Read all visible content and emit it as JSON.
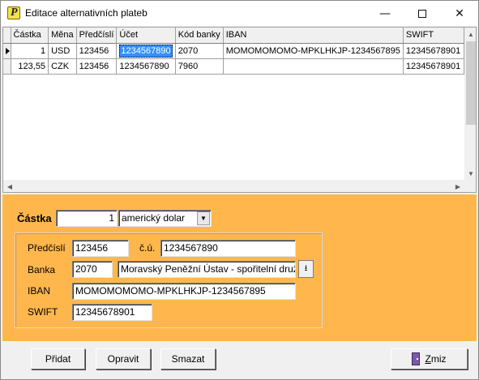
{
  "window": {
    "title": "Editace alternativních plateb",
    "controls": {
      "minimize": "—",
      "close": "✕"
    }
  },
  "grid": {
    "columns": [
      "Částka",
      "Měna",
      "Předčíslí",
      "Účet",
      "Kód banky",
      "IBAN",
      "SWIFT"
    ],
    "rows": [
      {
        "castka": "1",
        "mena": "USD",
        "predcisli": "123456",
        "ucet": "1234567890",
        "kod_banky": "2070",
        "iban": "MOMOMOMOMO-MPKLHKJP-1234567895",
        "swift": "12345678901",
        "current": true
      },
      {
        "castka": "123,55",
        "mena": "CZK",
        "predcisli": "123456",
        "ucet": "1234567890",
        "kod_banky": "7960",
        "iban": "",
        "swift": "12345678901",
        "current": false
      }
    ]
  },
  "form": {
    "castka_label": "Částka",
    "castka_value": "1",
    "mena_value": "americký dolar",
    "predcisli_label": "Předčíslí",
    "predcisli_value": "123456",
    "cu_label": "č.ú.",
    "cu_value": "1234567890",
    "banka_label": "Banka",
    "banka_code": "2070",
    "banka_name": "Moravský Peněžní Ústav - spořitelní druž",
    "iban_label": "IBAN",
    "iban_value": "MOMOMOMOMO-MPKLHKJP-1234567895",
    "swift_label": "SWIFT",
    "swift_value": "12345678901"
  },
  "buttons": {
    "add": "Přidat",
    "edit": "Opravit",
    "delete": "Smazat",
    "cancel_rest": "miz",
    "cancel_underlined": "Z"
  },
  "colors": {
    "panel": "#ffb74d",
    "selection": "#3390ff"
  }
}
